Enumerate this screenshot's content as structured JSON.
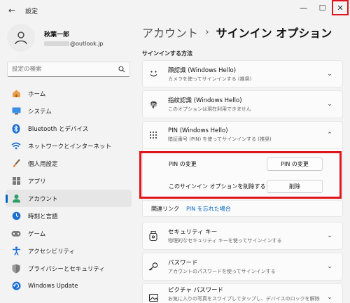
{
  "window": {
    "title": "設定",
    "back_glyph": "←",
    "minimize_glyph": "—",
    "maximize_glyph": "☐",
    "close_glyph": "✕"
  },
  "profile": {
    "name": "秋葉一郎",
    "email_suffix": "@outlook.jp"
  },
  "search": {
    "placeholder": "設定の検索"
  },
  "nav": [
    {
      "label": "ホーム",
      "icon": "home-icon"
    },
    {
      "label": "システム",
      "icon": "system-icon"
    },
    {
      "label": "Bluetooth とデバイス",
      "icon": "bluetooth-icon"
    },
    {
      "label": "ネットワークとインターネット",
      "icon": "wifi-icon"
    },
    {
      "label": "個人用設定",
      "icon": "brush-icon"
    },
    {
      "label": "アプリ",
      "icon": "apps-icon"
    },
    {
      "label": "アカウント",
      "icon": "account-icon",
      "active": true
    },
    {
      "label": "時刻と言語",
      "icon": "clock-icon"
    },
    {
      "label": "ゲーム",
      "icon": "gamepad-icon"
    },
    {
      "label": "アクセシビリティ",
      "icon": "accessibility-icon"
    },
    {
      "label": "プライバシーとセキュリティ",
      "icon": "shield-icon"
    },
    {
      "label": "Windows Update",
      "icon": "update-icon"
    }
  ],
  "main": {
    "breadcrumb_parent": "アカウント",
    "breadcrumb_sep": "›",
    "breadcrumb_current": "サインイン オプション",
    "section_title": "サインインする方法",
    "options": [
      {
        "title": "顔認識 (Windows Hello)",
        "subtitle": "カメラを使ってサインインする (推奨)",
        "icon": "face-icon",
        "chevron": "⌄"
      },
      {
        "title": "指紋認識 (Windows Hello)",
        "subtitle": "このオプションは現在利用できません",
        "icon": "fingerprint-icon",
        "chevron": "⌄"
      },
      {
        "title": "PIN (Windows Hello)",
        "subtitle": "暗証番号 (PIN) を使ってサインインする (推奨)",
        "icon": "pin-icon",
        "chevron": "⌃"
      },
      {
        "title": "セキュリティ キー",
        "subtitle": "物理的なセキュリティ キーを使ってサインインする",
        "icon": "security-key-icon",
        "chevron": "⌄"
      },
      {
        "title": "パスワード",
        "subtitle": "アカウントのパスワードを使ってサインインする",
        "icon": "key-icon",
        "chevron": "⌄"
      },
      {
        "title": "ピクチャ パスワード",
        "subtitle": "お気に入りの写真をスワイプしてタップし、デバイスのロックを解除する",
        "icon": "picture-icon",
        "chevron": "⌄"
      }
    ],
    "pin_panel": {
      "change_label": "PIN の変更",
      "change_button": "PIN の変更",
      "remove_label": "このサインイン オプションを削除する",
      "remove_button": "削除",
      "related_label": "関連リンク",
      "related_link": "PIN を忘れた場合"
    }
  },
  "colors": {
    "accent": "#0067c0",
    "highlight": "#e0141b"
  }
}
